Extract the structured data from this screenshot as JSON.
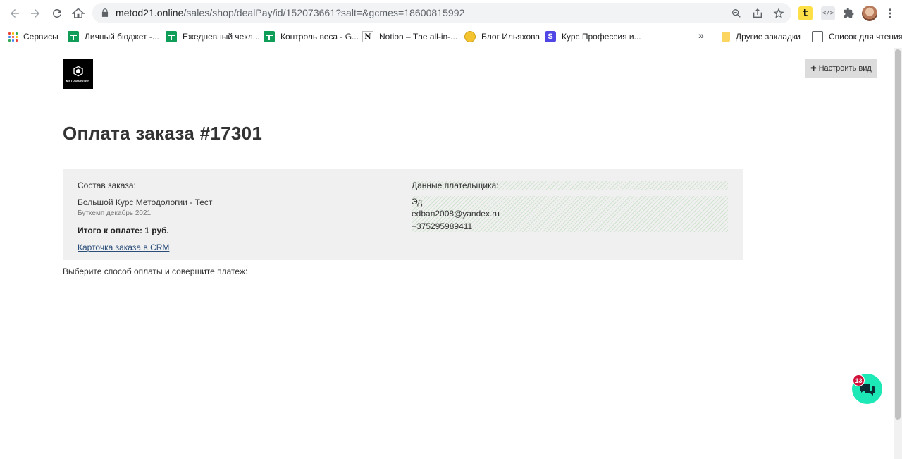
{
  "browser": {
    "url_host": "metod21.online",
    "url_path": "/sales/shop/dealPay/id/152073661?salt=&gcmes=18600815992",
    "extension_code_label": "</>",
    "extension_yellow_label": "t",
    "more_bookmarks": "»"
  },
  "bookmarks": {
    "items": [
      {
        "label": "Сервисы",
        "icon": "apps-grid-icon"
      },
      {
        "label": "Личный бюджет -...",
        "icon": "sheets-icon"
      },
      {
        "label": "Ежедневный чекл...",
        "icon": "sheets-icon"
      },
      {
        "label": "Контроль веса - G...",
        "icon": "sheets-icon"
      },
      {
        "label": "Notion – The all-in-...",
        "icon": "notion-icon"
      },
      {
        "label": "Блог Ильяхова",
        "icon": "coin-icon"
      },
      {
        "label": "Курс Профессия и...",
        "icon": "letter-s-icon"
      }
    ],
    "other_bookmarks": "Другие закладки",
    "reading_list": "Список для чтения"
  },
  "page": {
    "logo_text": "МЕТОДОЛОГИЯ",
    "customize_button": "Настроить вид",
    "title": "Оплата заказа #17301",
    "order": {
      "composition_label": "Состав заказа:",
      "product_name": "Большой Курс Методологии - Тест",
      "product_sub": "Буткемп декабрь 2021",
      "total_label": "Итого к оплате: 1 руб.",
      "crm_link": "Карточка заказа в CRM"
    },
    "payer": {
      "label": "Данные плательщика:",
      "name": "Эд",
      "email": "edban2008@yandex.ru",
      "phone": "+375295989411"
    },
    "instruction": "Выберите способ оплаты и совершите платеж:",
    "chat_badge_count": "13"
  }
}
